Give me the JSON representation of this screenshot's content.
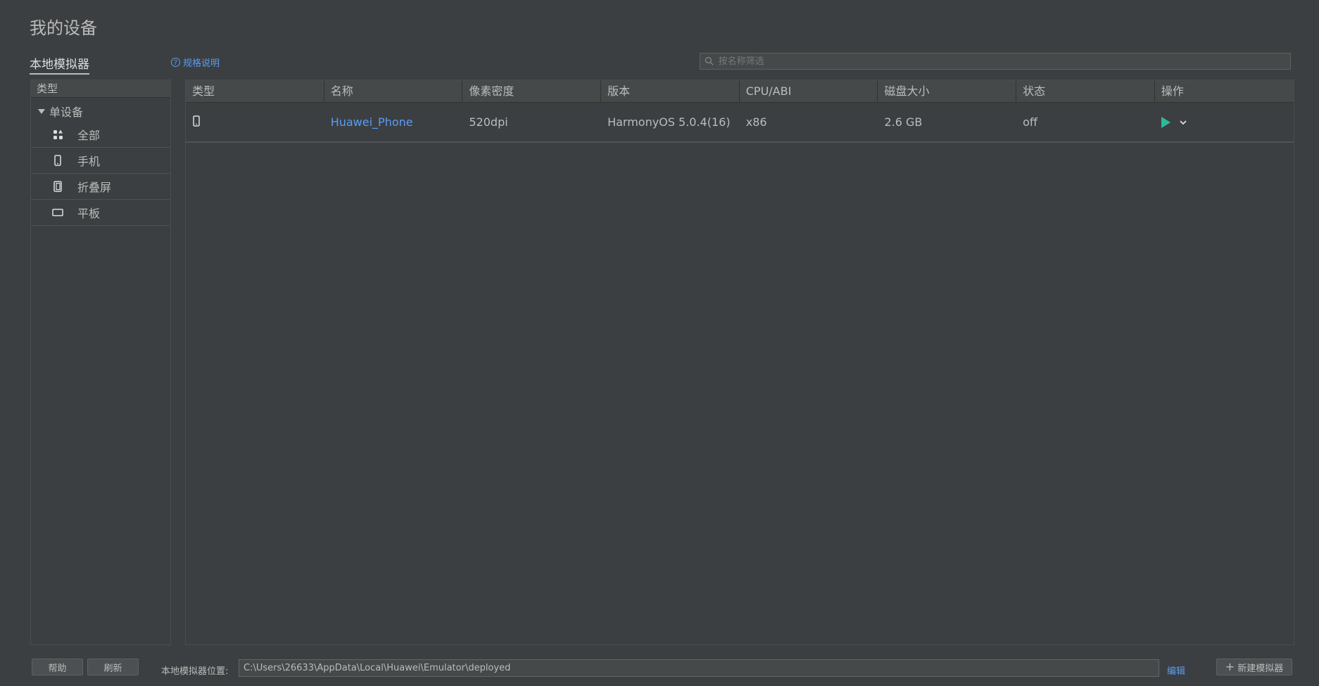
{
  "page": {
    "title": "我的设备"
  },
  "tabs": {
    "local": "本地模拟器"
  },
  "spec": {
    "label": "规格说明"
  },
  "search": {
    "placeholder": "按名称筛选"
  },
  "sidebar": {
    "header": "类型",
    "group": "单设备",
    "items": [
      {
        "label": "全部",
        "icon": "grid-icon"
      },
      {
        "label": "手机",
        "icon": "phone-icon"
      },
      {
        "label": "折叠屏",
        "icon": "foldable-icon"
      },
      {
        "label": "平板",
        "icon": "tablet-icon"
      }
    ]
  },
  "table": {
    "columns": [
      "类型",
      "名称",
      "像素密度",
      "版本",
      "CPU/ABI",
      "磁盘大小",
      "状态",
      "操作"
    ],
    "rows": [
      {
        "type_icon": "phone-icon",
        "name": "Huawei_Phone",
        "density": "520dpi",
        "version": "HarmonyOS 5.0.4(16)",
        "cpu": "x86",
        "disk": "2.6 GB",
        "status": "off"
      }
    ]
  },
  "footer": {
    "help": "帮助",
    "refresh": "刷新",
    "location_label": "本地模拟器位置:",
    "location_value": "C:\\Users\\26633\\AppData\\Local\\Huawei\\Emulator\\deployed",
    "edit": "编辑",
    "new_emulator": "新建模拟器"
  },
  "colors": {
    "accent": "#589df6",
    "play": "#2fb99c",
    "background": "#3c3f41"
  }
}
